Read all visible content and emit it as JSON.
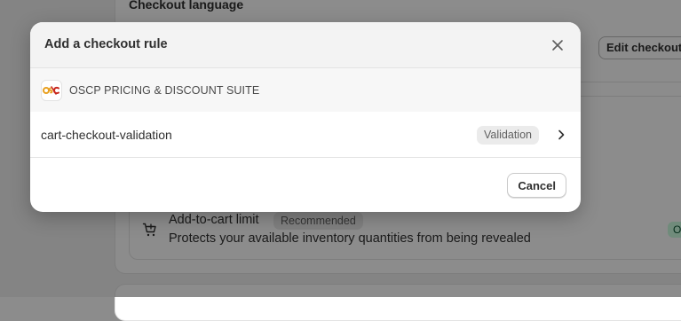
{
  "background": {
    "section_heading": "Checkout language",
    "edit_button_label": "Edit checkout content",
    "rule_title": "Add-to-cart limit",
    "rule_badge": "Recommended",
    "rule_description": "Protects your available inventory quantities from being revealed",
    "status_badge": "On",
    "icon": "cart-icon"
  },
  "modal": {
    "title": "Add a checkout rule",
    "close_icon": "close-icon",
    "app": {
      "logo_icon": "oscp-logo-icon",
      "name": "OSCP PRICING & DISCOUNT SUITE"
    },
    "rules": [
      {
        "name": "cart-checkout-validation",
        "badge": "Validation",
        "icon": "chevron-right-icon"
      }
    ],
    "cancel_label": "Cancel"
  },
  "colors": {
    "backdrop": "#8c8c8c",
    "modal_header_bg": "#f3f3f3",
    "badge_bg": "#ebebeb",
    "logo_orange": "#e8a020",
    "logo_red": "#c8281e"
  }
}
